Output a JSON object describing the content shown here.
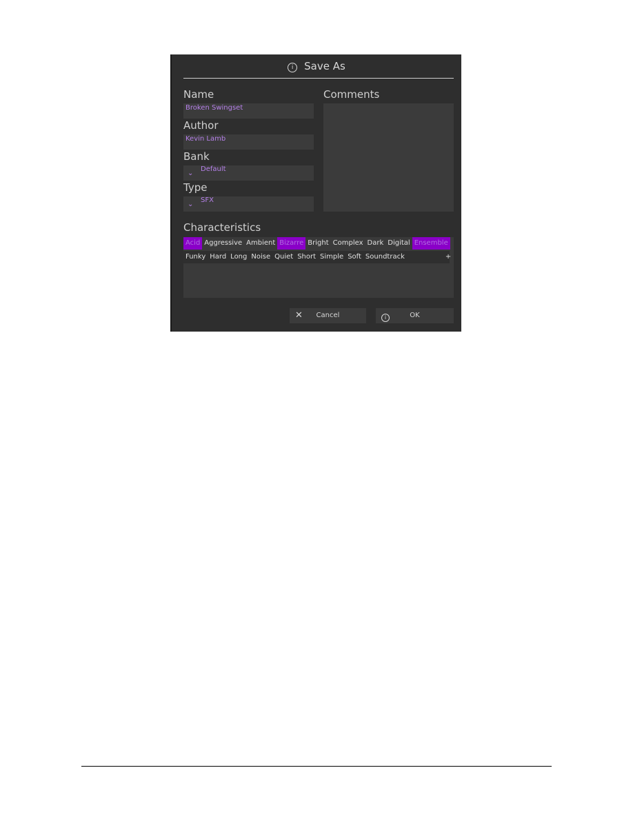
{
  "dialog": {
    "title": "Save As",
    "title_icon": "info-icon"
  },
  "fields": {
    "name": {
      "label": "Name",
      "value": "Broken Swingset"
    },
    "author": {
      "label": "Author",
      "value": "Kevin Lamb"
    },
    "bank": {
      "label": "Bank",
      "value": "Default"
    },
    "type": {
      "label": "Type",
      "value": "SFX"
    },
    "comments": {
      "label": "Comments",
      "value": ""
    }
  },
  "characteristics": {
    "label": "Characteristics",
    "selected_color": "#8a00c8",
    "row1": [
      {
        "label": "Acid",
        "selected": true
      },
      {
        "label": "Aggressive",
        "selected": false
      },
      {
        "label": "Ambient",
        "selected": false
      },
      {
        "label": "Bizarre",
        "selected": true
      },
      {
        "label": "Bright",
        "selected": false
      },
      {
        "label": "Complex",
        "selected": false
      },
      {
        "label": "Dark",
        "selected": false
      },
      {
        "label": "Digital",
        "selected": false
      },
      {
        "label": "Ensemble",
        "selected": true
      }
    ],
    "row2": [
      {
        "label": "Funky"
      },
      {
        "label": "Hard"
      },
      {
        "label": "Long"
      },
      {
        "label": "Noise"
      },
      {
        "label": "Quiet"
      },
      {
        "label": "Short"
      },
      {
        "label": "Simple"
      },
      {
        "label": "Soft"
      },
      {
        "label": "Soundtrack"
      }
    ],
    "add_label": "+"
  },
  "buttons": {
    "cancel": "Cancel",
    "ok": "OK"
  }
}
